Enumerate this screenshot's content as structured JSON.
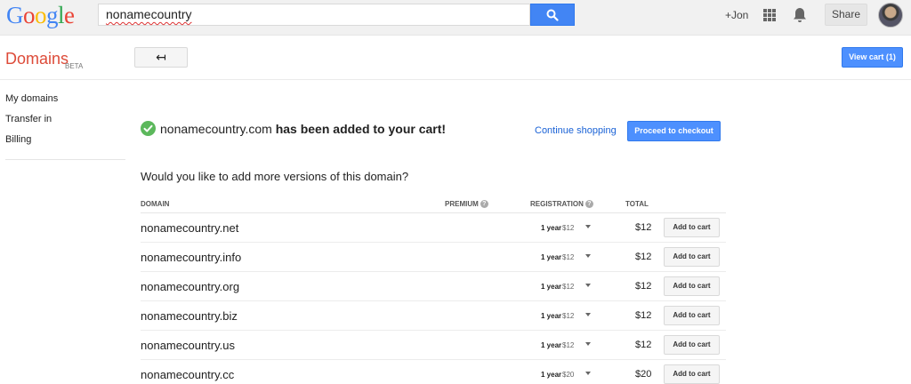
{
  "topbar": {
    "logo_letters": [
      {
        "ch": "G",
        "color": "#4285f4"
      },
      {
        "ch": "o",
        "color": "#ea4335"
      },
      {
        "ch": "o",
        "color": "#fbbc05"
      },
      {
        "ch": "g",
        "color": "#4285f4"
      },
      {
        "ch": "l",
        "color": "#34a853"
      },
      {
        "ch": "e",
        "color": "#ea4335"
      }
    ],
    "search_value": "nonamecountry",
    "user_link": "+Jon",
    "share_label": "Share"
  },
  "header": {
    "app_title": "Domains",
    "beta_badge": "BETA",
    "back_label": "↤",
    "view_cart_label": "View cart (1)"
  },
  "sidebar": {
    "items": [
      {
        "label": "My domains"
      },
      {
        "label": "Transfer in"
      },
      {
        "label": "Billing"
      }
    ]
  },
  "confirmation": {
    "domain": "nonamecountry.com",
    "message": "has been added to your cart!",
    "continue_label": "Continue shopping",
    "checkout_label": "Proceed to checkout"
  },
  "upsell": {
    "question": "Would you like to add more versions of this domain?",
    "columns": {
      "domain": "DOMAIN",
      "premium": "PREMIUM",
      "registration": "REGISTRATION",
      "total": "TOTAL"
    },
    "rows": [
      {
        "domain": "nonamecountry.net",
        "term": "1 year",
        "price": "$12",
        "total": "$12",
        "add_label": "Add to cart"
      },
      {
        "domain": "nonamecountry.info",
        "term": "1 year",
        "price": "$12",
        "total": "$12",
        "add_label": "Add to cart"
      },
      {
        "domain": "nonamecountry.org",
        "term": "1 year",
        "price": "$12",
        "total": "$12",
        "add_label": "Add to cart"
      },
      {
        "domain": "nonamecountry.biz",
        "term": "1 year",
        "price": "$12",
        "total": "$12",
        "add_label": "Add to cart"
      },
      {
        "domain": "nonamecountry.us",
        "term": "1 year",
        "price": "$12",
        "total": "$12",
        "add_label": "Add to cart"
      },
      {
        "domain": "nonamecountry.cc",
        "term": "1 year",
        "price": "$20",
        "total": "$20",
        "add_label": "Add to cart"
      }
    ]
  },
  "colors": {
    "accent_blue": "#4d90fe",
    "brand_red": "#dd4b39",
    "success_green": "#5cb85c",
    "link_blue": "#1a62d6"
  }
}
